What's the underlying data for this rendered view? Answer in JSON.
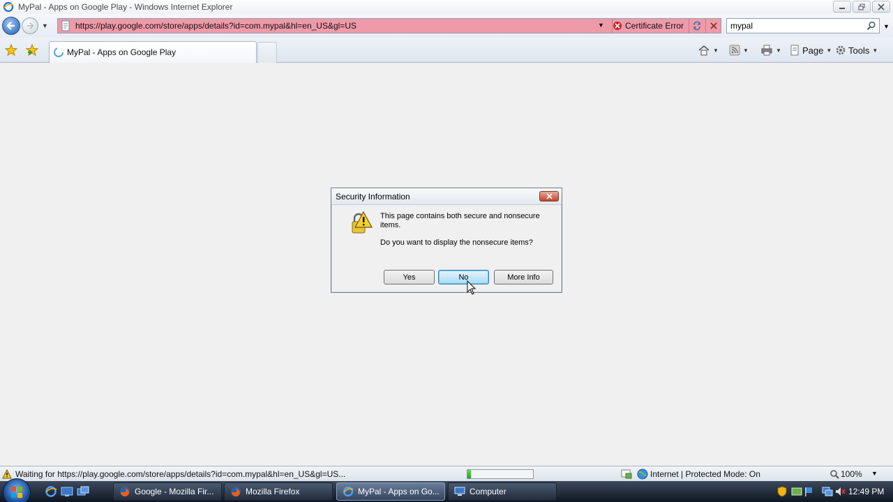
{
  "window": {
    "title": "MyPal - Apps on Google Play - Windows Internet Explorer"
  },
  "address_bar": {
    "url": "https://play.google.com/store/apps/details?id=com.mypal&hl=en_US&gl=US",
    "certificate_error_label": "Certificate Error"
  },
  "search": {
    "value": "mypal"
  },
  "tabs": [
    {
      "label": "MyPal - Apps on Google Play"
    }
  ],
  "command_bar": {
    "page_label": "Page",
    "tools_label": "Tools"
  },
  "dialog": {
    "title": "Security Information",
    "message_line1": "This page contains both secure and nonsecure items.",
    "message_line2": "Do you want to display the nonsecure items?",
    "buttons": {
      "yes": "Yes",
      "no": "No",
      "more_info": "More Info"
    }
  },
  "status_bar": {
    "text": "Waiting for https://play.google.com/store/apps/details?id=com.mypal&hl=en_US&gl=US...",
    "progress": 0.05,
    "zone": "Internet | Protected Mode: On",
    "zoom": "100%"
  },
  "taskbar": {
    "buttons": [
      {
        "label": "Google - Mozilla Fir...",
        "icon": "firefox-icon"
      },
      {
        "label": "Mozilla Firefox",
        "icon": "firefox-icon"
      },
      {
        "label": "MyPal - Apps on Go...",
        "icon": "ie-icon",
        "active": true
      },
      {
        "label": "Computer",
        "icon": "computer-icon"
      }
    ],
    "clock": "12:49 PM"
  },
  "colors": {
    "address_error_bg": "#ef9aa8",
    "focus_button": "#a9dbf6",
    "progress_fill": "#1aa31a"
  }
}
